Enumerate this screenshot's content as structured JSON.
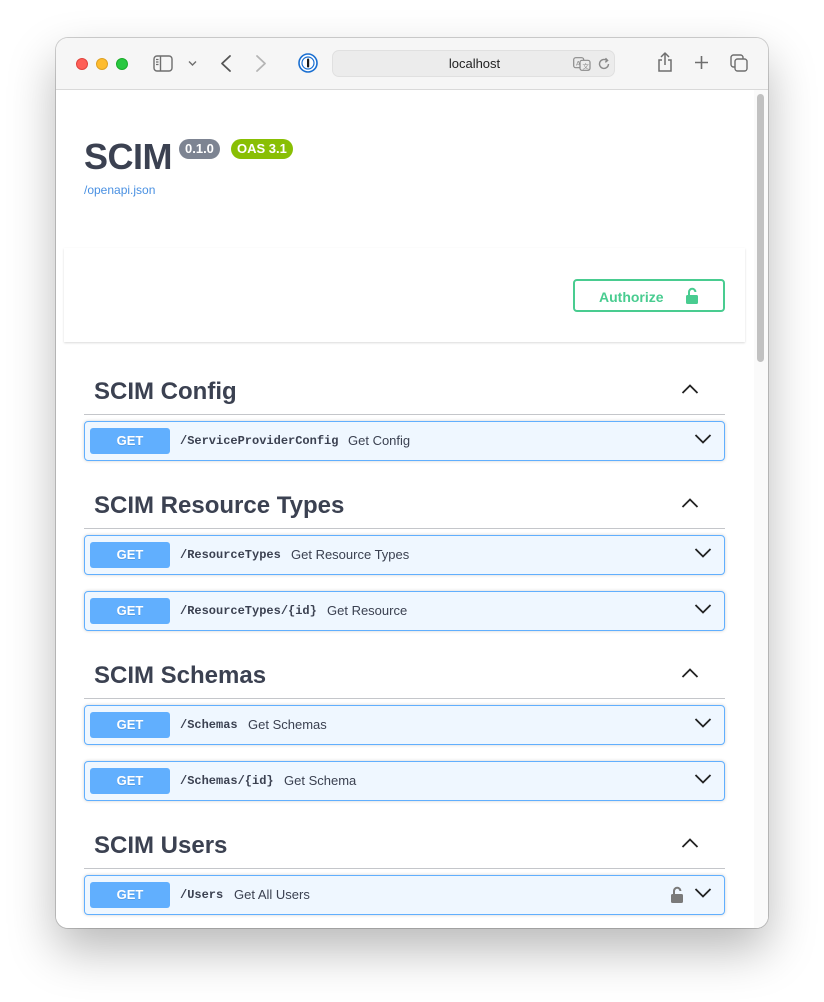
{
  "browser": {
    "url": "localhost"
  },
  "api": {
    "title": "SCIM",
    "version": "0.1.0",
    "oas": "OAS 3.1",
    "spec_link": "/openapi.json"
  },
  "authorize": {
    "label": "Authorize"
  },
  "tags": [
    {
      "name": "SCIM Config",
      "operations": [
        {
          "method": "GET",
          "path": "/ServiceProviderConfig",
          "summary": "Get Config"
        }
      ]
    },
    {
      "name": "SCIM Resource Types",
      "operations": [
        {
          "method": "GET",
          "path": "/ResourceTypes",
          "summary": "Get Resource Types"
        },
        {
          "method": "GET",
          "path": "/ResourceTypes/{id}",
          "summary": "Get Resource"
        }
      ]
    },
    {
      "name": "SCIM Schemas",
      "operations": [
        {
          "method": "GET",
          "path": "/Schemas",
          "summary": "Get Schemas"
        },
        {
          "method": "GET",
          "path": "/Schemas/{id}",
          "summary": "Get Schema"
        }
      ]
    },
    {
      "name": "SCIM Users",
      "operations": [
        {
          "method": "GET",
          "path": "/Users",
          "summary": "Get All Users",
          "locked": true
        }
      ]
    }
  ],
  "colors": {
    "get_accent": "#61affe",
    "authorize_accent": "#49cc90",
    "version_badge": "#7d8492",
    "oas_badge": "#89bf04"
  }
}
